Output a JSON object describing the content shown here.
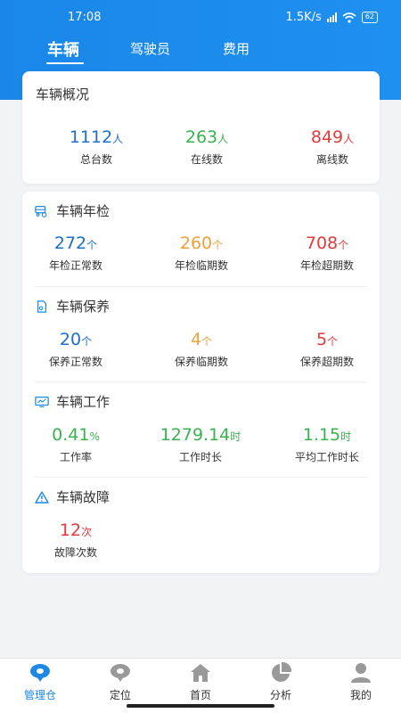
{
  "status_bar": {
    "time": "17:08",
    "network": "1.5K/s",
    "battery": "62"
  },
  "tabs": [
    {
      "label": "车辆"
    },
    {
      "label": "驾驶员"
    },
    {
      "label": "费用"
    }
  ],
  "overview": {
    "title": "车辆概况",
    "stats": [
      {
        "value": "1112",
        "unit": "人",
        "label": "总台数"
      },
      {
        "value": "263",
        "unit": "人",
        "label": "在线数"
      },
      {
        "value": "849",
        "unit": "人",
        "label": "离线数"
      }
    ]
  },
  "sections": {
    "inspection": {
      "title": "车辆年检",
      "stats": [
        {
          "value": "272",
          "unit": "个",
          "label": "年检正常数"
        },
        {
          "value": "260",
          "unit": "个",
          "label": "年检临期数"
        },
        {
          "value": "708",
          "unit": "个",
          "label": "年检超期数"
        }
      ]
    },
    "maintenance": {
      "title": "车辆保养",
      "stats": [
        {
          "value": "20",
          "unit": "个",
          "label": "保养正常数"
        },
        {
          "value": "4",
          "unit": "个",
          "label": "保养临期数"
        },
        {
          "value": "5",
          "unit": "个",
          "label": "保养超期数"
        }
      ]
    },
    "work": {
      "title": "车辆工作",
      "stats": [
        {
          "value": "0.41",
          "unit": "%",
          "label": "工作率"
        },
        {
          "value": "1279.14",
          "unit": "时",
          "label": "工作时长"
        },
        {
          "value": "1.15",
          "unit": "时",
          "label": "平均工作时长"
        }
      ]
    },
    "fault": {
      "title": "车辆故障",
      "stats": [
        {
          "value": "12",
          "unit": "次",
          "label": "故障次数"
        }
      ]
    }
  },
  "bottom_nav": [
    {
      "label": "管理仓",
      "icon": "location-pin-icon"
    },
    {
      "label": "定位",
      "icon": "location-pin-icon"
    },
    {
      "label": "首页",
      "icon": "home-icon"
    },
    {
      "label": "分析",
      "icon": "pie-chart-icon"
    },
    {
      "label": "我的",
      "icon": "user-icon"
    }
  ],
  "colors": {
    "primary": "#1e88e5",
    "blue": "#1d6fc9",
    "green": "#37b24d",
    "red": "#e03b3b",
    "orange": "#f0a03a"
  }
}
